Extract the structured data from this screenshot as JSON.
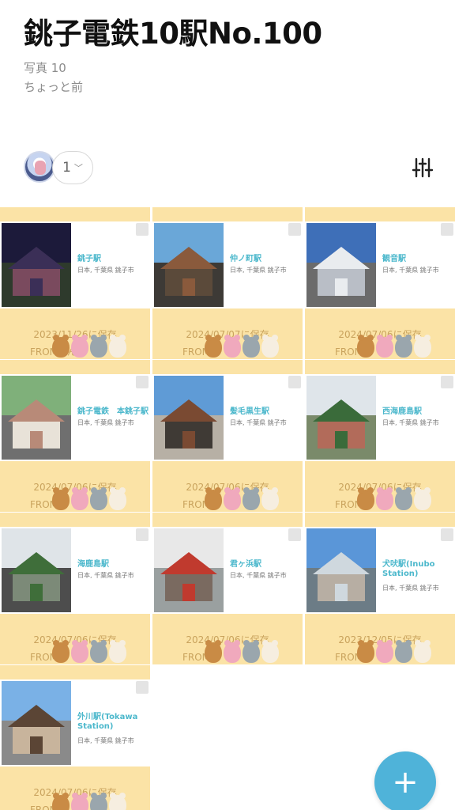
{
  "album": {
    "title": "銚子電鉄10駅No.100",
    "photo_count": "写真 10",
    "updated": "ちょっと前"
  },
  "members": {
    "count": "1"
  },
  "colors": {
    "band": "#fbe3a6",
    "accent": "#4cb8cc",
    "fab": "#4fb3d9"
  },
  "icons": {
    "filter": "sliders-icon",
    "add": "plus-icon",
    "dropdown": "chevron-down-icon"
  },
  "photos": [
    {
      "name": "銚子駅",
      "address": "日本, 千葉県 銚子市",
      "saved": "2023/11/26に保存",
      "from_label": "FROM：",
      "from_name": "ん"
    },
    {
      "name": "仲ノ町駅",
      "address": "日本, 千葉県 銚子市",
      "saved": "2024/07/07に保存",
      "from_label": "FROM：",
      "from_name": ""
    },
    {
      "name": "観音駅",
      "address": "日本, 千葉県 銚子市",
      "saved": "2024/07/06に保存",
      "from_label": "FROM：",
      "from_name": ""
    },
    {
      "name": "銚子電鉄　本銚子駅",
      "address": "日本, 千葉県 銚子市",
      "saved": "2024/07/06に保存",
      "from_label": "FROM：",
      "from_name": ""
    },
    {
      "name": "髪毛黒生駅",
      "address": "日本, 千葉県 銚子市",
      "saved": "2024/07/06に保存",
      "from_label": "FROM：",
      "from_name": ""
    },
    {
      "name": "西海鹿島駅",
      "address": "日本, 千葉県 銚子市",
      "saved": "2024/07/06に保存",
      "from_label": "FROM：",
      "from_name": ""
    },
    {
      "name": "海鹿島駅",
      "address": "日本, 千葉県 銚子市",
      "saved": "2024/07/06に保存",
      "from_label": "FROM：",
      "from_name": ""
    },
    {
      "name": "君ヶ浜駅",
      "address": "日本, 千葉県 銚子市",
      "saved": "2024/07/06に保存",
      "from_label": "FROM：",
      "from_name": ""
    },
    {
      "name": "犬吠駅(Inubo Station)",
      "address": "日本, 千葉県 銚子市",
      "saved": "2023/12/05に保存",
      "from_label": "FROM：",
      "from_name": ""
    },
    {
      "name": "外川駅(Tokawa Station)",
      "address": "日本, 千葉県 銚子市",
      "saved": "2024/07/06に保存",
      "from_label": "FROM：",
      "from_name": ""
    }
  ]
}
